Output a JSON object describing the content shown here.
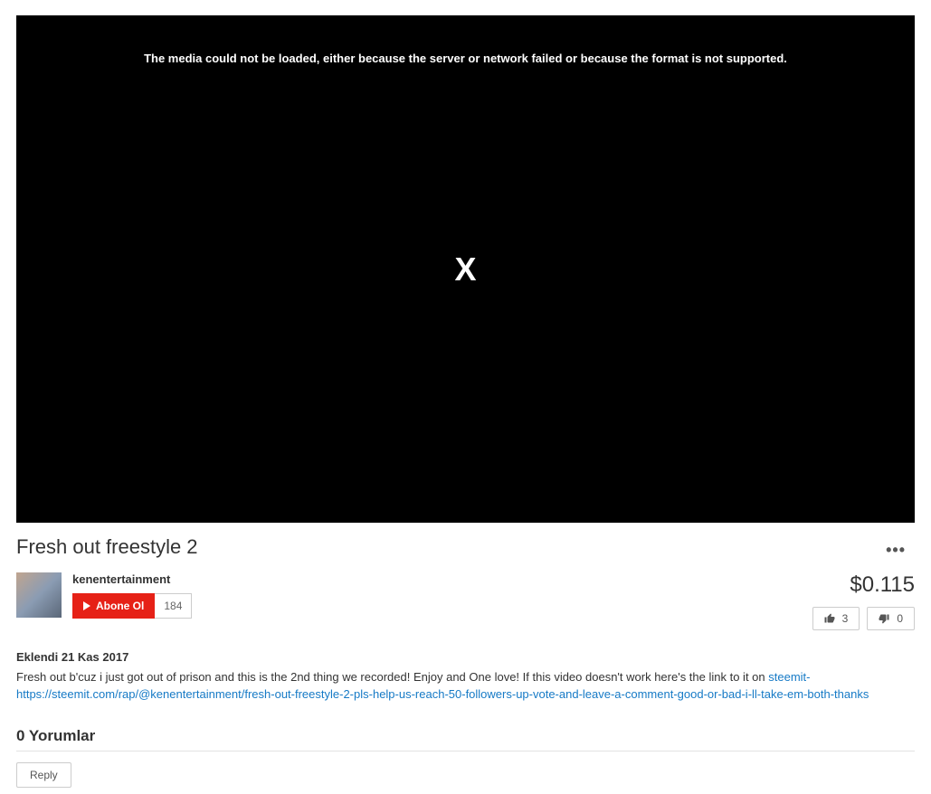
{
  "video": {
    "error_message": "The media could not be loaded, either because the server or network failed or because the format is not supported.",
    "x_symbol": "X"
  },
  "title": "Fresh out freestyle 2",
  "channel": {
    "name": "kenentertainment",
    "subscribe_label": "Abone Ol",
    "subscriber_count": "184"
  },
  "reward_value": "$0.115",
  "votes": {
    "up_count": "3",
    "down_count": "0"
  },
  "description": {
    "date_label": "Eklendi 21 Kas 2017",
    "text_prefix": "Fresh out b'cuz i just got out of prison and this is the 2nd thing we recorded! Enjoy and One love! If this video doesn't work here's the link to it on ",
    "link_text": "steemit- https://steemit.com/rap/@kenentertainment/fresh-out-freestyle-2-pls-help-us-reach-50-followers-up-vote-and-leave-a-comment-good-or-bad-i-ll-take-em-both-thanks"
  },
  "comments": {
    "header": "0 Yorumlar",
    "reply_label": "Reply"
  },
  "more_icon": "•••"
}
